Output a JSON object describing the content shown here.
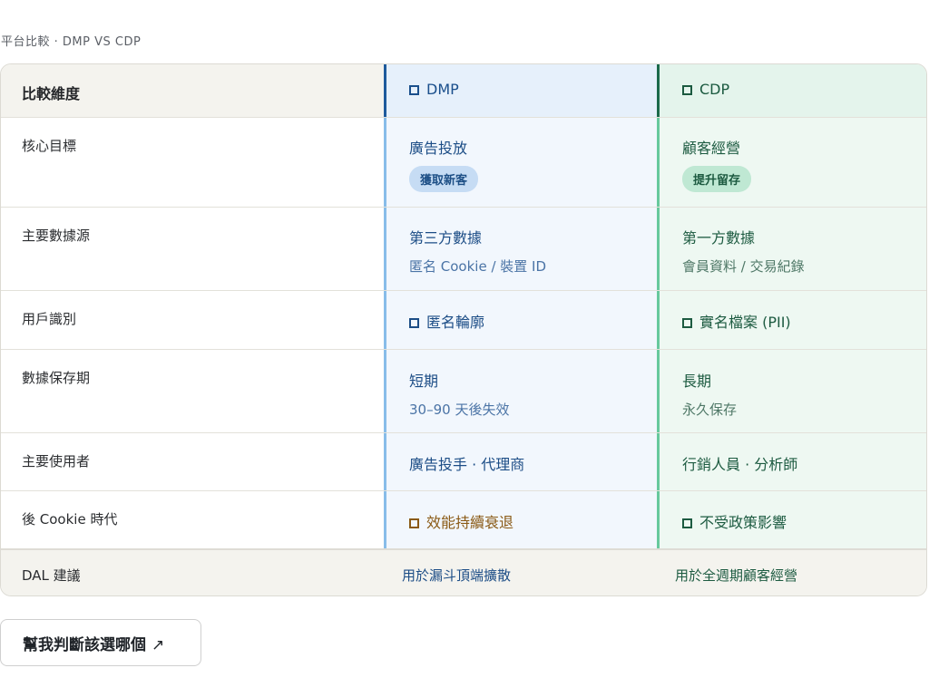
{
  "eyebrow": "平台比較 · DMP VS CDP",
  "header": {
    "dimension_label": "比較維度",
    "dmp_label": "DMP",
    "cdp_label": "CDP",
    "dmp_icon": "square-icon",
    "cdp_icon": "square-icon"
  },
  "rows": [
    {
      "label": "核心目標",
      "dmp_main": "廣告投放",
      "dmp_badge": "獲取新客",
      "cdp_main": "顧客經營",
      "cdp_badge": "提升留存"
    },
    {
      "label": "主要數據源",
      "dmp_main": "第三方數據",
      "dmp_sub": "匿名 Cookie / 裝置 ID",
      "cdp_main": "第一方數據",
      "cdp_sub": "會員資料 / 交易紀錄"
    },
    {
      "label": "用戶識別",
      "dmp_main": "匿名輪廓",
      "cdp_main": "實名檔案 (PII)"
    },
    {
      "label": "數據保存期",
      "dmp_main": "短期",
      "dmp_sub": "30–90 天後失效",
      "cdp_main": "長期",
      "cdp_sub": "永久保存"
    },
    {
      "label": "主要使用者",
      "dmp_main": "廣告投手 · 代理商",
      "cdp_main": "行銷人員 · 分析師"
    },
    {
      "label": "後 Cookie 時代",
      "dmp_main": "效能持續衰退",
      "cdp_main": "不受政策影響"
    }
  ],
  "footer": {
    "label": "DAL 建議",
    "dmp": "用於漏斗頂端擴散",
    "cdp": "用於全週期顧客經營"
  },
  "cta": {
    "label": "幫我判斷該選哪個",
    "icon": "arrow-up-right-icon",
    "arrow": "↗"
  },
  "colors": {
    "dmp_accent": "#1e5a9c",
    "cdp_accent": "#1b6a4a",
    "warning": "#8a5a15"
  }
}
